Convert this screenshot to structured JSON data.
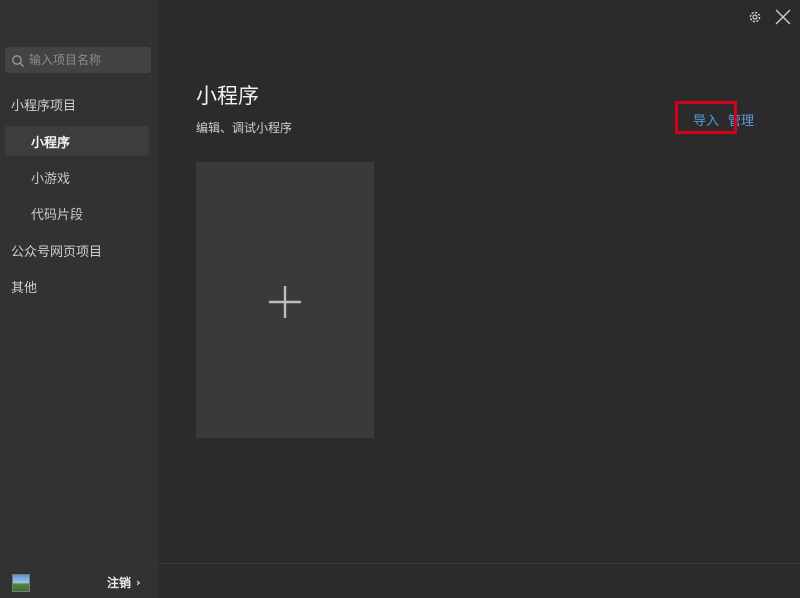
{
  "search": {
    "placeholder": "输入项目名称"
  },
  "sidebar": {
    "groups": [
      {
        "label": "小程序项目"
      },
      {
        "label": "公众号网页项目"
      },
      {
        "label": "其他"
      }
    ],
    "items": [
      {
        "label": "小程序",
        "active": true
      },
      {
        "label": "小游戏",
        "active": false
      },
      {
        "label": "代码片段",
        "active": false
      }
    ],
    "footer": {
      "logout_label": "注销",
      "chevron": "›"
    }
  },
  "main": {
    "title": "小程序",
    "subtitle": "编辑、调试小程序",
    "actions": {
      "import_label": "导入",
      "manage_label": "管理"
    },
    "new_project_icon": "plus-icon"
  },
  "window_controls": {
    "settings_icon": "gear-icon",
    "close_icon": "close-icon"
  },
  "colors": {
    "accent": "#5b9bd5",
    "highlight": "#d0021b",
    "background": "#2b2b2b",
    "sidebar": "#323232"
  }
}
